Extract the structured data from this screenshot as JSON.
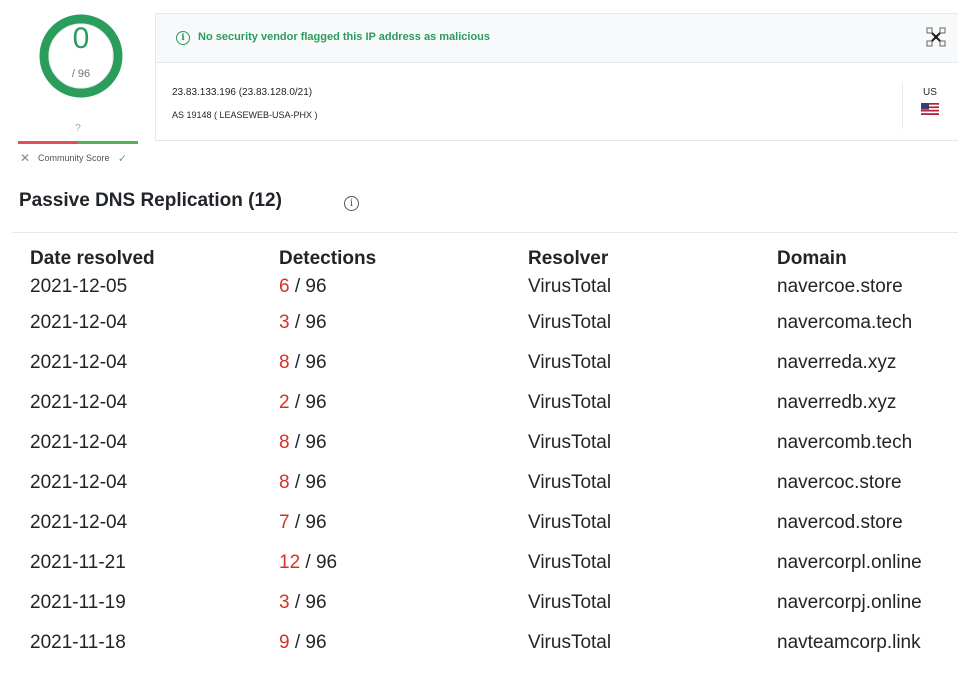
{
  "score": {
    "detections": "0",
    "total": "/ 96",
    "ring_color": "#2a9d5a"
  },
  "community": {
    "question": "?",
    "label": "Community Score",
    "down_icon": "close-icon",
    "up_icon": "check-icon"
  },
  "banner": {
    "message": "No security vendor flagged this IP address as malicious",
    "color": "#2a9d5a"
  },
  "ip": {
    "address": "23.83.133.196  (23.83.128.0/21)",
    "as": "AS 19148 ( LEASEWEB-USA-PHX )",
    "country": "US"
  },
  "section": {
    "title": "Passive DNS Replication (12)"
  },
  "table": {
    "headers": [
      "Date resolved",
      "Detections",
      "Resolver",
      "Domain"
    ],
    "rows": [
      {
        "date": "2021-12-05",
        "det": "6",
        "total": " / 96",
        "resolver": "VirusTotal",
        "domain": "navercoe.store"
      },
      {
        "date": "2021-12-04",
        "det": "3",
        "total": " / 96",
        "resolver": "VirusTotal",
        "domain": "navercoma.tech"
      },
      {
        "date": "2021-12-04",
        "det": "8",
        "total": " / 96",
        "resolver": "VirusTotal",
        "domain": "naverreda.xyz"
      },
      {
        "date": "2021-12-04",
        "det": "2",
        "total": " / 96",
        "resolver": "VirusTotal",
        "domain": "naverredb.xyz"
      },
      {
        "date": "2021-12-04",
        "det": "8",
        "total": " / 96",
        "resolver": "VirusTotal",
        "domain": "navercomb.tech"
      },
      {
        "date": "2021-12-04",
        "det": "8",
        "total": " / 96",
        "resolver": "VirusTotal",
        "domain": "navercoc.store"
      },
      {
        "date": "2021-12-04",
        "det": "7",
        "total": " / 96",
        "resolver": "VirusTotal",
        "domain": "navercod.store"
      },
      {
        "date": "2021-11-21",
        "det": "12",
        "total": " / 96",
        "resolver": "VirusTotal",
        "domain": "navercorpl.online"
      },
      {
        "date": "2021-11-19",
        "det": "3",
        "total": " / 96",
        "resolver": "VirusTotal",
        "domain": "navercorpj.online"
      },
      {
        "date": "2021-11-18",
        "det": "9",
        "total": " / 96",
        "resolver": "VirusTotal",
        "domain": "navteamcorp.link"
      }
    ]
  }
}
